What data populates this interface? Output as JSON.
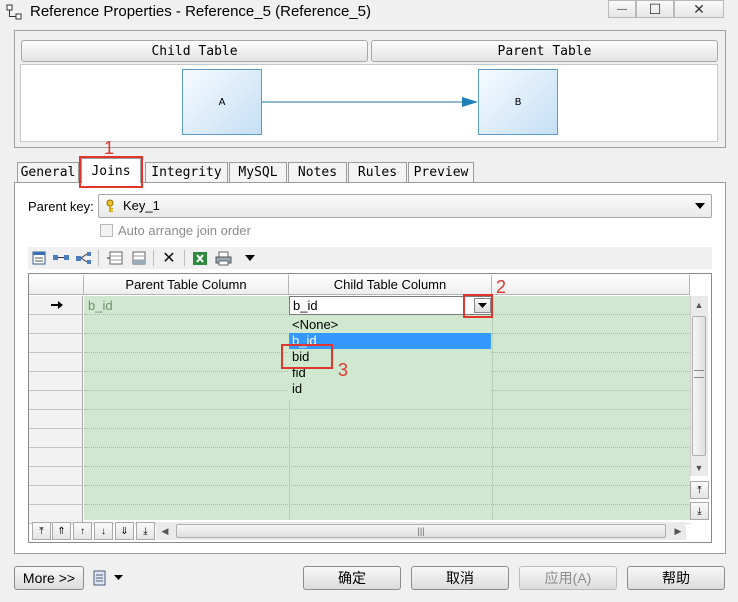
{
  "window": {
    "title": "Reference Properties - Reference_5 (Reference_5)",
    "minimize_glyph": "—",
    "maximize_glyph": "☐",
    "close_glyph": "✕"
  },
  "header": {
    "child_table": "Child Table",
    "parent_table": "Parent Table"
  },
  "diagram": {
    "entity_a": "A",
    "entity_b": "B"
  },
  "tabs": [
    {
      "label": "General"
    },
    {
      "label": "Joins"
    },
    {
      "label": "Integrity"
    },
    {
      "label": "MySQL"
    },
    {
      "label": "Notes"
    },
    {
      "label": "Rules"
    },
    {
      "label": "Preview"
    }
  ],
  "annotations": {
    "one": "1",
    "two": "2",
    "three": "3"
  },
  "parent_key": {
    "label": "Parent key:",
    "value": "Key_1"
  },
  "auto_arrange": {
    "label": "Auto arrange join order",
    "checked": false,
    "enabled": false
  },
  "grid": {
    "columns": [
      "Parent Table Column",
      "Child Table Column"
    ],
    "row": {
      "parent": "b_id",
      "child": "b_id"
    }
  },
  "dropdown": {
    "options": [
      "<None>",
      "b_id",
      "bid",
      "fid",
      "id"
    ],
    "selected": "b_id"
  },
  "buttons": {
    "more": "More >>",
    "ok": "确定",
    "cancel": "取消",
    "apply": "应用(A)",
    "help": "帮助"
  }
}
